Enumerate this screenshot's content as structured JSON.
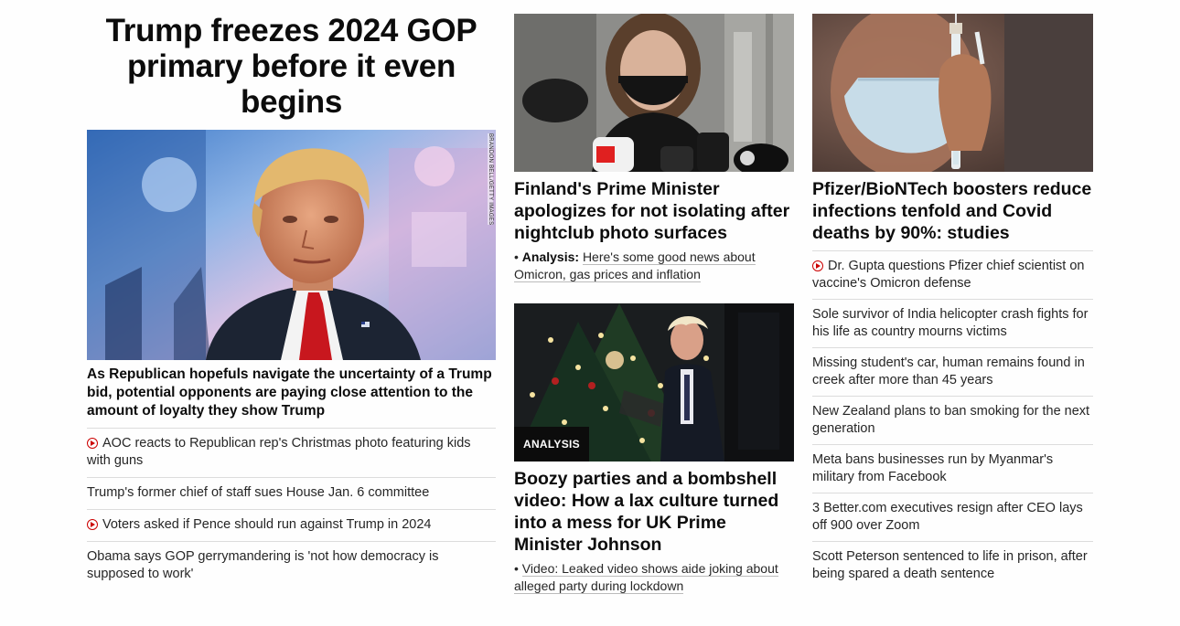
{
  "lead": {
    "title": "Trump freezes 2024 GOP primary before it even begins",
    "image_credit": "BRANDON BELL/GETTY IMAGES",
    "subhead": "As Republican hopefuls navigate the uncertainty of a Trump bid, potential opponents are paying close attention to the amount of loyalty they show Trump",
    "related": [
      {
        "text": "AOC reacts to Republican rep's Christmas photo featuring kids with guns",
        "video": true
      },
      {
        "text": "Trump's former chief of staff sues House Jan. 6 committee",
        "video": false
      },
      {
        "text": "Voters asked if Pence should run against Trump in 2024",
        "video": true
      },
      {
        "text": "Obama says GOP gerrymandering is 'not how democracy is supposed to work'",
        "video": false
      }
    ]
  },
  "finland": {
    "headline": "Finland's Prime Minister apologizes for not isolating after nightclub photo surfaces",
    "related_prefix": "Analysis:",
    "related_text": "Here's some good news about Omicron, gas prices and inflation"
  },
  "boris": {
    "badge": "ANALYSIS",
    "headline": "Boozy parties and a bombshell video: How a lax culture turned into a mess for UK Prime Minister Johnson",
    "related_text": "Video: Leaked video shows aide joking about alleged party during lockdown"
  },
  "pfizer": {
    "headline": "Pfizer/BioNTech boosters reduce infections tenfold and Covid deaths by 90%: studies",
    "list": [
      {
        "text": "Dr. Gupta questions Pfizer chief scientist on vaccine's Omicron defense",
        "video": true
      },
      {
        "text": "Sole survivor of India helicopter crash fights for his life as country mourns victims",
        "video": false
      },
      {
        "text": "Missing student's car, human remains found in creek after more than 45 years",
        "video": false
      },
      {
        "text": "New Zealand plans to ban smoking for the next generation",
        "video": false
      },
      {
        "text": "Meta bans businesses run by Myanmar's military from Facebook",
        "video": false
      },
      {
        "text": "3 Better.com executives resign after CEO lays off 900 over Zoom",
        "video": false
      },
      {
        "text": "Scott Peterson sentenced to life in prison, after being spared a death sentence",
        "video": false
      }
    ]
  },
  "colors": {
    "video_red": "#cc0000",
    "badge_bg": "#0c0c0c",
    "divider": "#dcdcdc"
  }
}
